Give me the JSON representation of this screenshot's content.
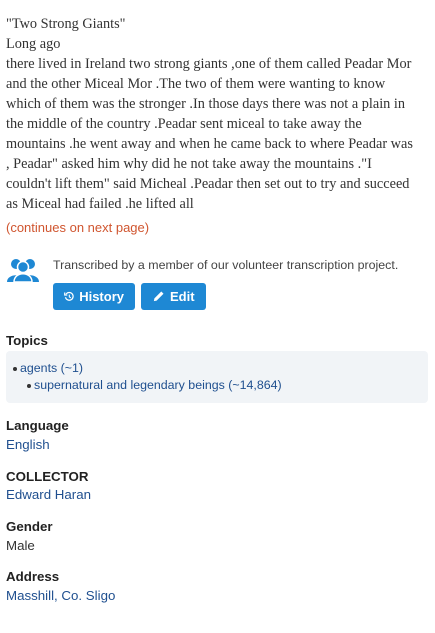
{
  "story": {
    "lines": [
      "\"Two Strong Giants\"",
      "Long ago",
      "there lived in Ireland two strong giants ,one of them called Peadar Mor",
      "and the other Miceal Mor .The two of them were wanting to know",
      "which of them was the stronger .In those days there was not a plain in",
      "the middle of the country .Peadar sent miceal to take away the",
      "mountains .he went away and when he came back to where Peadar was",
      ", Peadar\" asked him why did he not take away the mountains .\"I",
      "couldn't lift them\" said Micheal .Peadar then set out to try and succeed",
      "as Miceal had failed .he lifted all"
    ]
  },
  "continues_label": "(continues on next page)",
  "transcription": {
    "text": "Transcribed by a member of our volunteer transcription project.",
    "history_label": "History",
    "edit_label": "Edit"
  },
  "topics": {
    "heading": "Topics",
    "items": [
      "agents (~1)",
      "supernatural and legendary beings (~14,864)"
    ]
  },
  "language": {
    "heading": "Language",
    "value": "English"
  },
  "collector": {
    "heading": "COLLECTOR",
    "value": "Edward Haran"
  },
  "gender": {
    "heading": "Gender",
    "value": "Male"
  },
  "address": {
    "heading": "Address",
    "value": "Masshill, Co. Sligo"
  },
  "colors": {
    "accent": "#1e88d4",
    "link": "#1f4f8f",
    "continues": "#d0552f"
  }
}
